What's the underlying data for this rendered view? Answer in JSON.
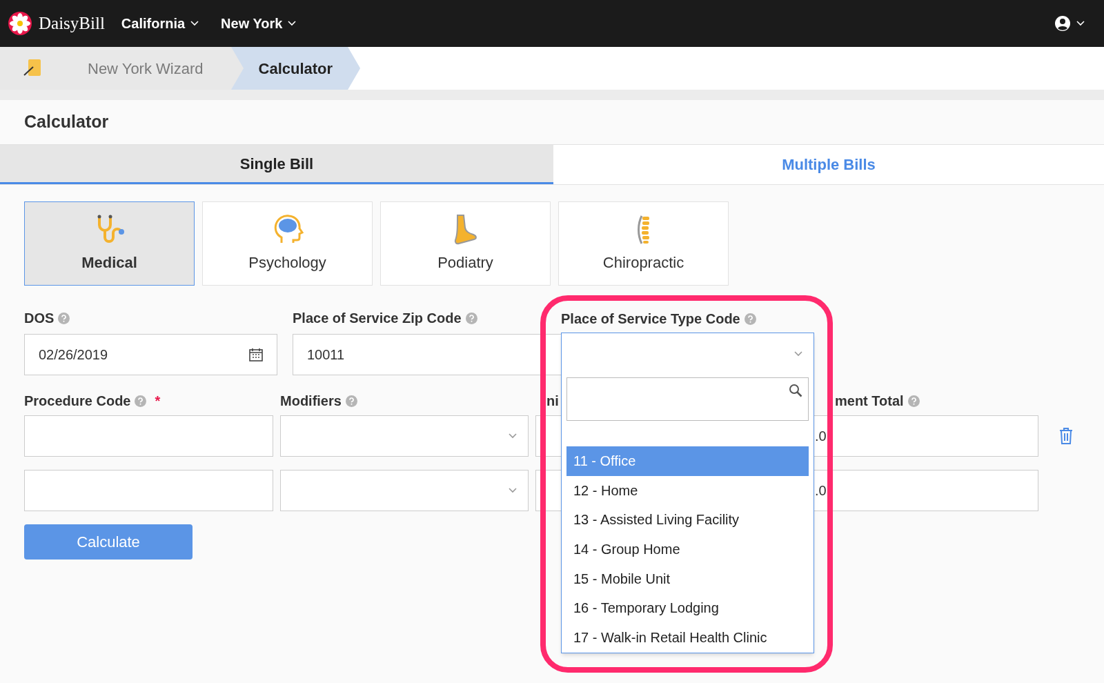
{
  "nav": {
    "brand": "DaisyBill",
    "menus": [
      {
        "label": "California"
      },
      {
        "label": "New York"
      }
    ]
  },
  "breadcrumbs": [
    {
      "label": "New York Wizard",
      "selected": false
    },
    {
      "label": "Calculator",
      "selected": true
    }
  ],
  "page_title": "Calculator",
  "tabs": [
    {
      "label": "Single Bill",
      "selected": true
    },
    {
      "label": "Multiple Bills",
      "selected": false
    }
  ],
  "specialties": [
    {
      "label": "Medical",
      "kind": "stethoscope",
      "selected": true
    },
    {
      "label": "Psychology",
      "kind": "brain",
      "selected": false
    },
    {
      "label": "Podiatry",
      "kind": "foot",
      "selected": false
    },
    {
      "label": "Chiropractic",
      "kind": "spine",
      "selected": false
    }
  ],
  "form": {
    "dos_label": "DOS",
    "dos_value": "02/26/2019",
    "zip_label": "Place of Service Zip Code",
    "zip_value": "10011",
    "procedure_label": "Procedure Code",
    "required_mark": "*",
    "modifiers_label": "Modifiers",
    "units_label": "ni",
    "total_label": "ment Total",
    "rows": [
      {
        "total": ".0",
        "deletable": true
      },
      {
        "total": ".0",
        "deletable": false
      }
    ]
  },
  "calculate_button": "Calculate",
  "place_of_service_type": {
    "label": "Place of Service Type Code",
    "options": [
      {
        "label": "11 - Office",
        "selected": true
      },
      {
        "label": "12 - Home",
        "selected": false
      },
      {
        "label": "13 - Assisted Living Facility",
        "selected": false
      },
      {
        "label": "14 - Group Home",
        "selected": false
      },
      {
        "label": "15 - Mobile Unit",
        "selected": false
      },
      {
        "label": "16 - Temporary Lodging",
        "selected": false
      },
      {
        "label": "17 - Walk-in Retail Health Clinic",
        "selected": false
      }
    ]
  }
}
